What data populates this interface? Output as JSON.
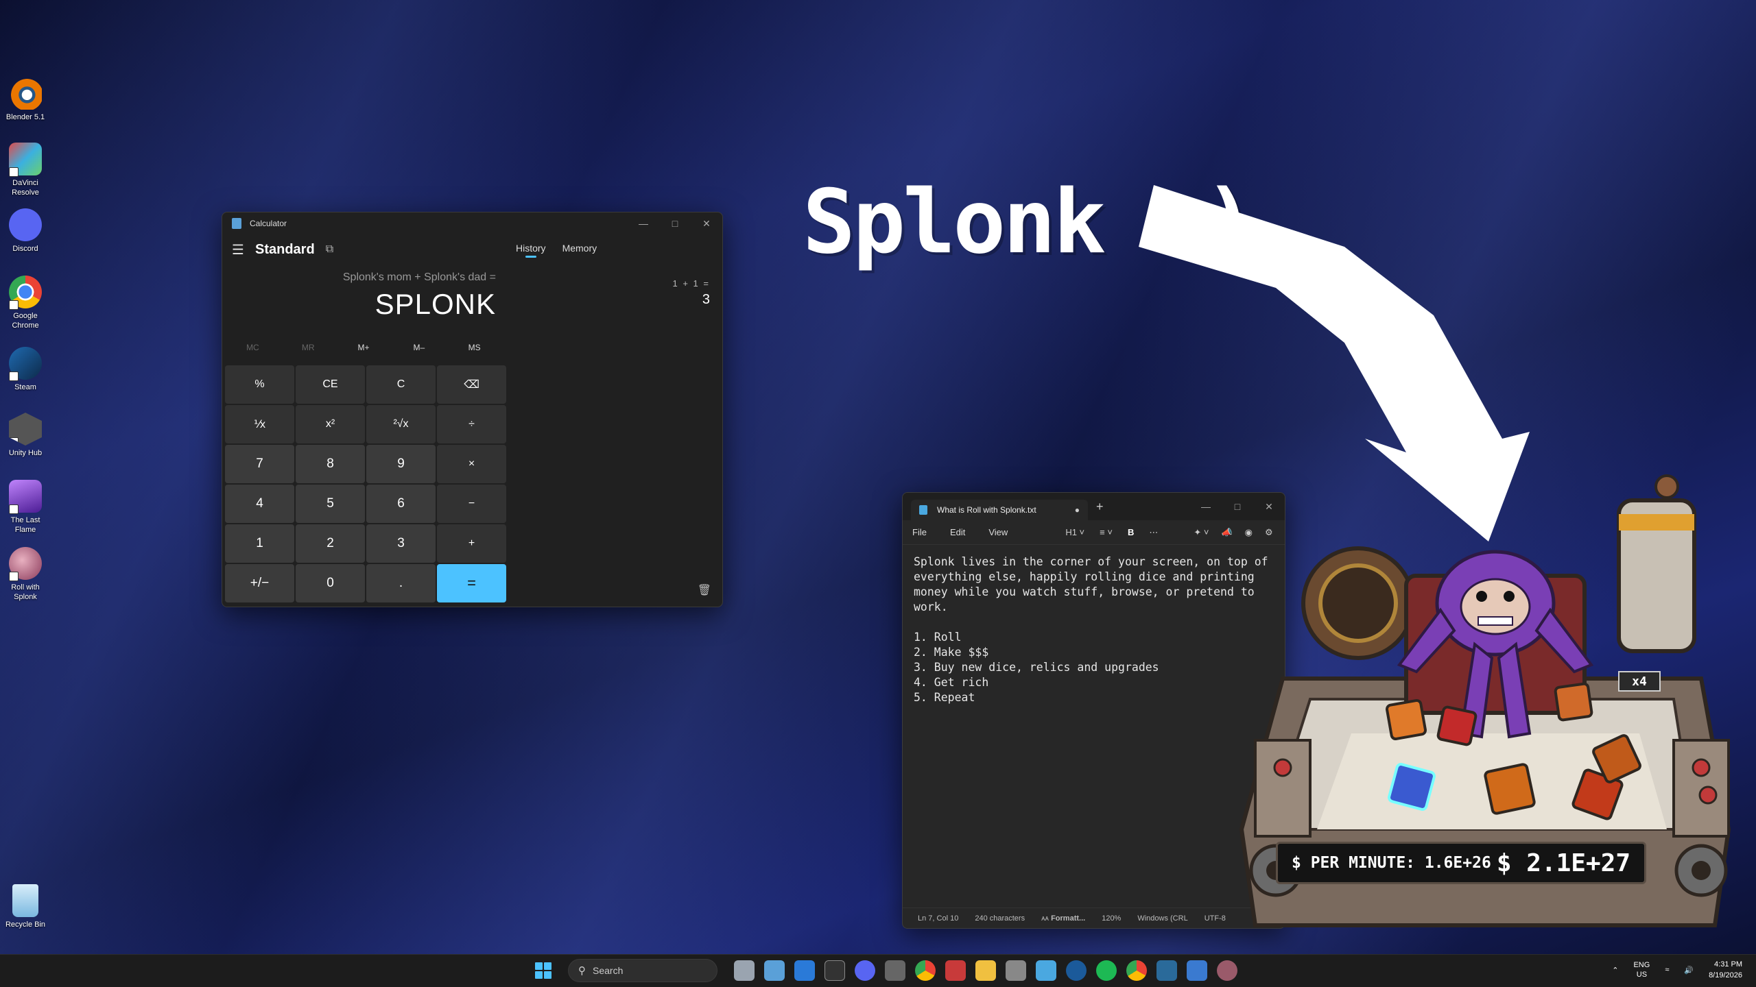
{
  "desktop": {
    "icons": [
      {
        "label": "Blender 5.1",
        "color": "#ea7600"
      },
      {
        "label": "DaVinci Resolve",
        "color": "#2a6a9a"
      },
      {
        "label": "Discord",
        "color": "#5865f2"
      },
      {
        "label": "Google Chrome",
        "color": "#34a853"
      },
      {
        "label": "Steam",
        "color": "#1b2838"
      },
      {
        "label": "Unity Hub",
        "color": "#555555"
      },
      {
        "label": "The Last Flame",
        "color": "#7a4ab0"
      },
      {
        "label": "Roll with Splonk",
        "color": "#9a5a6a"
      },
      {
        "label": "Recycle Bin",
        "color": "#9ad0f0"
      }
    ]
  },
  "calculator": {
    "title": "Calculator",
    "mode": "Standard",
    "tabs": [
      "History",
      "Memory"
    ],
    "expression": "Splonk's mom + Splonk's dad =",
    "display": "SPLONK",
    "history": {
      "expression": "1 + 1 =",
      "result": "3"
    },
    "memory_buttons": [
      "MC",
      "MR",
      "M+",
      "M–",
      "MS"
    ],
    "keys": [
      "%",
      "CE",
      "C",
      "⌫",
      "⅟x",
      "x²",
      "²√x",
      "÷",
      "7",
      "8",
      "9",
      "×",
      "4",
      "5",
      "6",
      "−",
      "1",
      "2",
      "3",
      "+",
      "+/−",
      "0",
      ".",
      "="
    ]
  },
  "notepad": {
    "tab_title": "What is Roll with Splonk.txt",
    "menu": [
      "File",
      "Edit",
      "View"
    ],
    "heading": "H1",
    "body": "Splonk lives in the corner of your screen, on top of\neverything else, happily rolling dice and printing\nmoney while you watch stuff, browse, or pretend to\nwork.\n\n1. Roll\n2. Make $$$\n3. Buy new dice, relics and upgrades\n4. Get rich\n5. Repeat",
    "status": {
      "position": "Ln 7, Col 10",
      "chars": "240 characters",
      "format": "Formatt...",
      "zoom": "120%",
      "line_ending": "Windows (CRL",
      "encoding": "UTF-8"
    }
  },
  "overlay": {
    "title": "Splonk :)"
  },
  "game": {
    "multiplier": "x4",
    "rate": "$ PER MINUTE: 1.6E+26",
    "total": "$ 2.1E+27"
  },
  "taskbar": {
    "search_placeholder": "Search",
    "lang_line1": "ENG",
    "lang_line2": "US",
    "time": "4:31 PM",
    "date": "8/19/2026"
  }
}
